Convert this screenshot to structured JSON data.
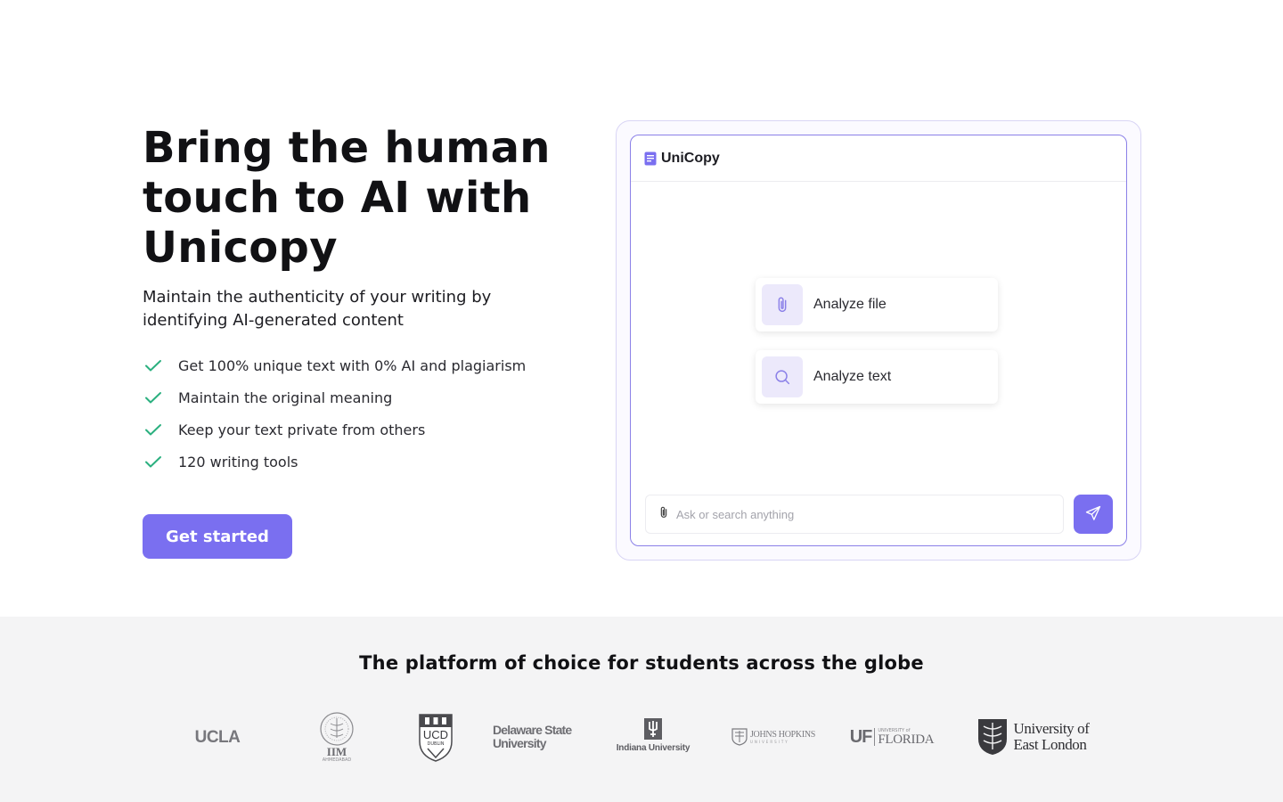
{
  "hero": {
    "headline": "Bring the human touch to AI with Unicopy",
    "subhead": "Maintain the authenticity of your writing by identifying AI-generated content",
    "features": [
      "Get 100% unique text with 0% AI and plagiarism",
      "Maintain the original meaning",
      "Keep your text private from others",
      "120 writing tools"
    ],
    "cta_label": "Get started",
    "check_color": "#2bb07f"
  },
  "mockup": {
    "brand": "UniCopy",
    "options": [
      {
        "label": "Analyze file",
        "icon": "paperclip-icon"
      },
      {
        "label": "Analyze text",
        "icon": "search-icon"
      }
    ],
    "input_placeholder": "Ask or search anything",
    "accent": "#7a6ff0"
  },
  "trust": {
    "title": "The platform of choice for students across the globe",
    "logos": [
      {
        "name": "UCLA",
        "text": "UCLA"
      },
      {
        "name": "IIM Ahmedabad",
        "text": "IIM",
        "subtext": "AHMEDABAD"
      },
      {
        "name": "UCD Dublin",
        "text": "UCD",
        "subtext": "DUBLIN"
      },
      {
        "name": "Delaware State University",
        "text": "Delaware State",
        "subtext": "University"
      },
      {
        "name": "Indiana University",
        "text": "Indiana University"
      },
      {
        "name": "Johns Hopkins University",
        "text": "JOHNS HOPKINS",
        "subtext": "UNIVERSITY"
      },
      {
        "name": "University of Florida",
        "text": "UF",
        "subtext": "UNIVERSITY of",
        "subtext2": "FLORIDA"
      },
      {
        "name": "University of East London",
        "text": "University of",
        "subtext": "East London"
      }
    ]
  }
}
